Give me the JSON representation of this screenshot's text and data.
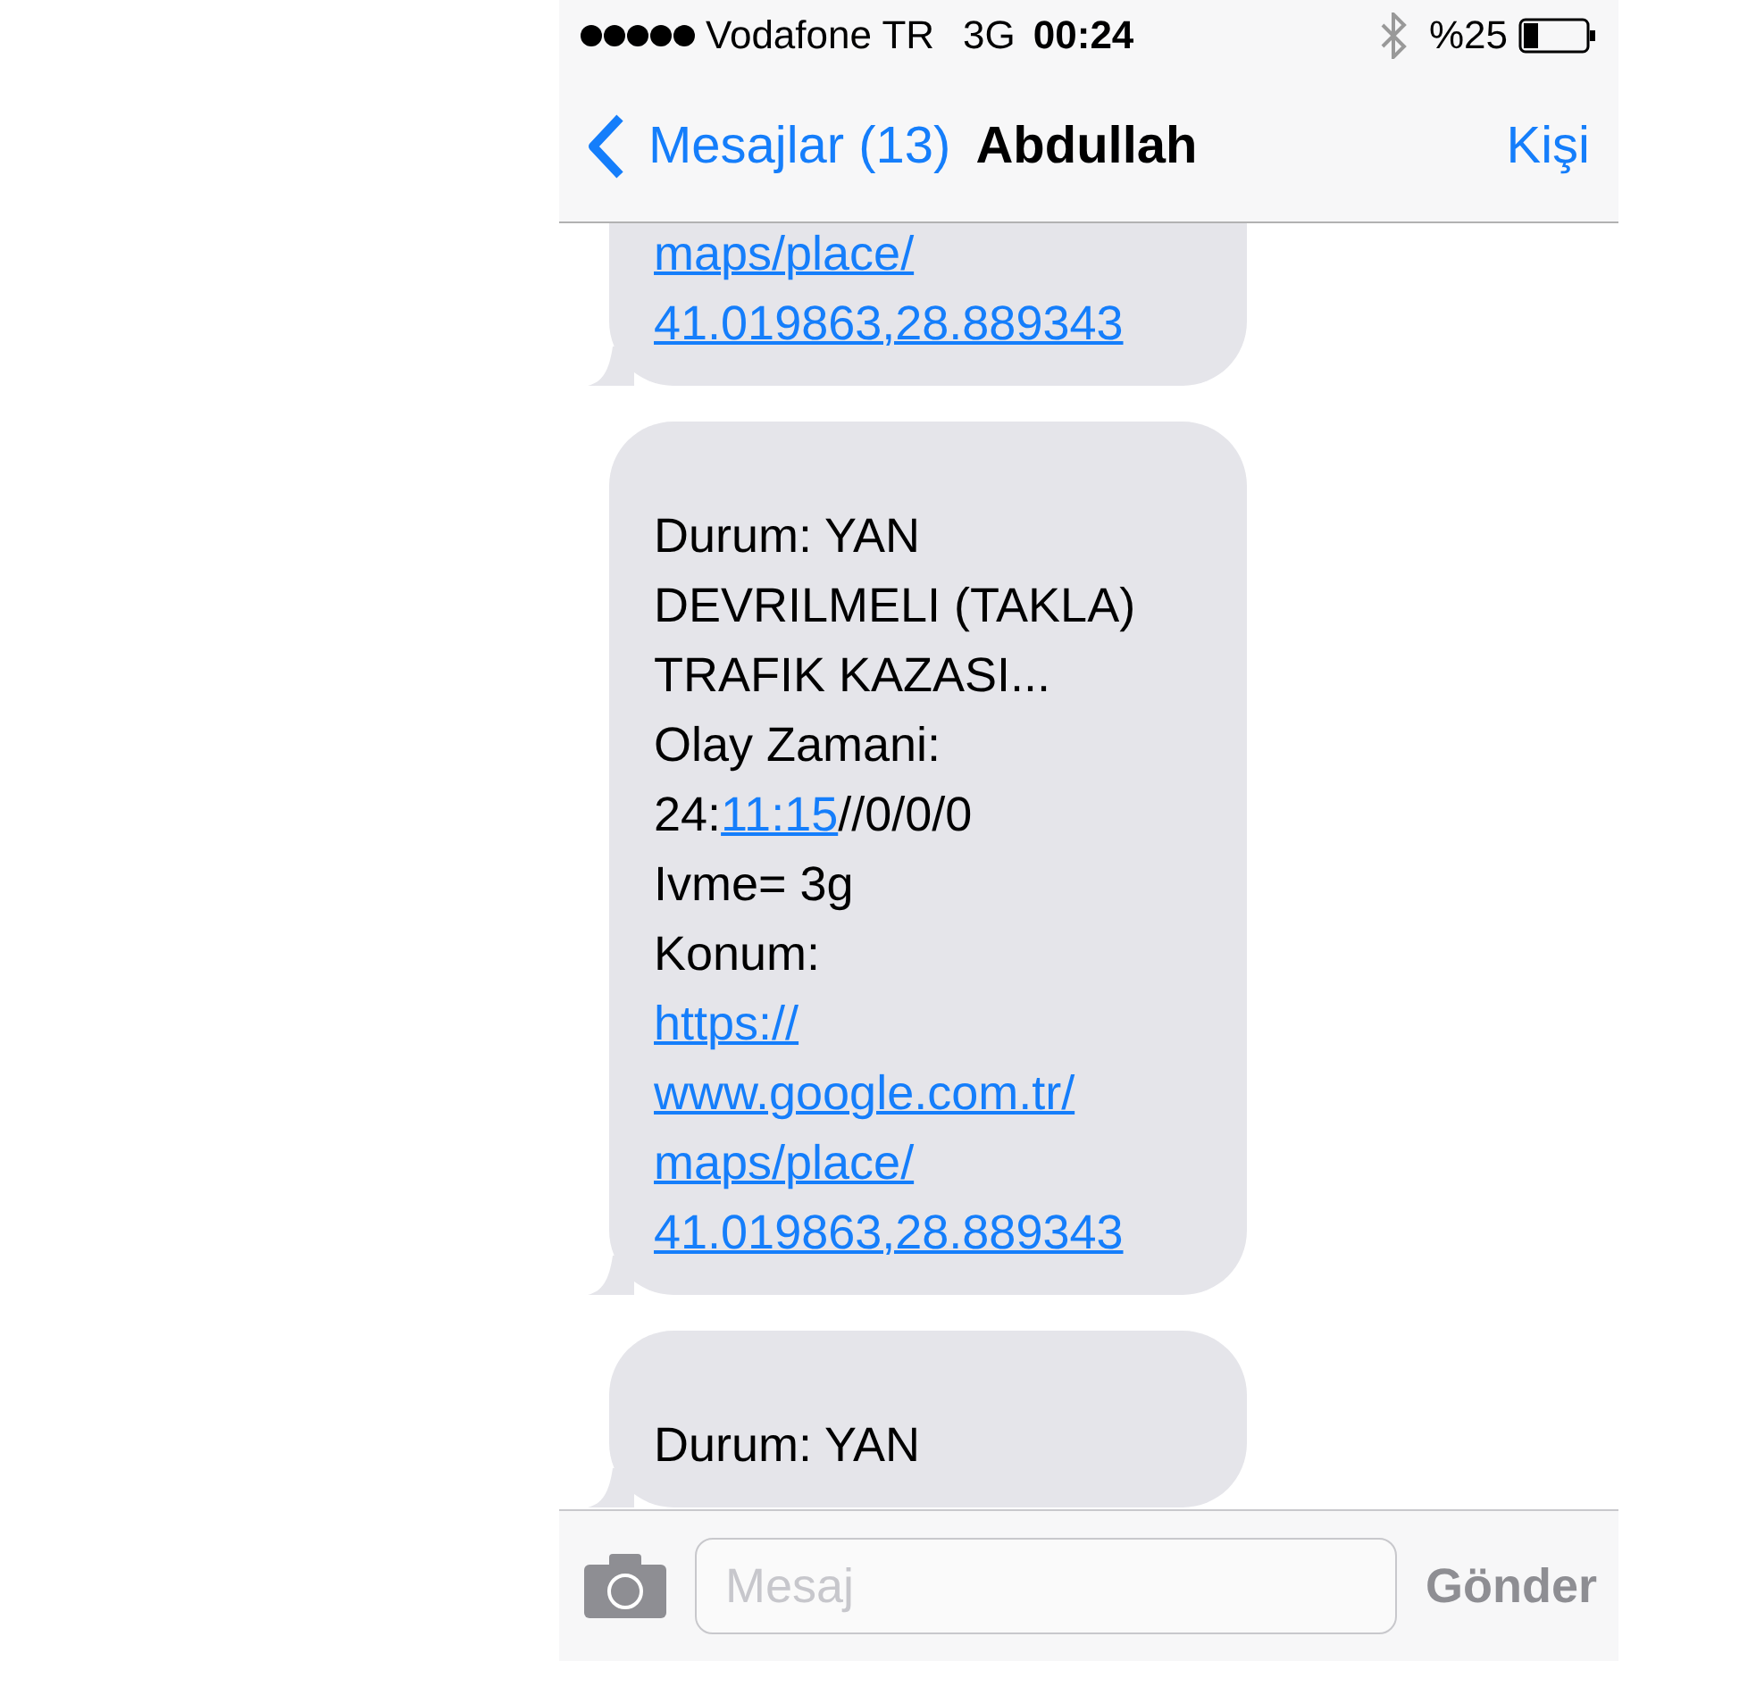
{
  "status_bar": {
    "carrier": "Vodafone TR",
    "network": "3G",
    "time": "00:24",
    "battery": "%25"
  },
  "nav_bar": {
    "back": "Mesajlar (13)",
    "title": "Abdullah",
    "action": "Kişi"
  },
  "messages": [
    {
      "lines": [
        [
          {
            "text": "maps/place/",
            "link": true
          }
        ],
        [
          {
            "text": "41.019863,28.889343",
            "link": true
          }
        ]
      ]
    },
    {
      "lines": [
        [
          {
            "text": "Durum: YAN",
            "link": false
          }
        ],
        [
          {
            "text": "DEVRILMELI (TAKLA)",
            "link": false
          }
        ],
        [
          {
            "text": "TRAFIK KAZASI...",
            "link": false
          }
        ],
        [
          {
            "text": "Olay Zamani:",
            "link": false
          }
        ],
        [
          {
            "text": "24:",
            "link": false
          },
          {
            "text": "11:15",
            "link": true
          },
          {
            "text": "//0/0/0",
            "link": false
          }
        ],
        [
          {
            "text": "Ivme= 3g",
            "link": false
          }
        ],
        [
          {
            "text": "Konum:",
            "link": false
          }
        ],
        [
          {
            "text": "https://",
            "link": true
          }
        ],
        [
          {
            "text": "www.google.com.tr/",
            "link": true
          }
        ],
        [
          {
            "text": "maps/place/",
            "link": true
          }
        ],
        [
          {
            "text": "41.019863,28.889343",
            "link": true
          }
        ]
      ]
    },
    {
      "lines": [
        [
          {
            "text": "Durum: YAN",
            "link": false
          }
        ]
      ]
    }
  ],
  "input_bar": {
    "placeholder": "Mesaj",
    "send": "Gönder"
  }
}
